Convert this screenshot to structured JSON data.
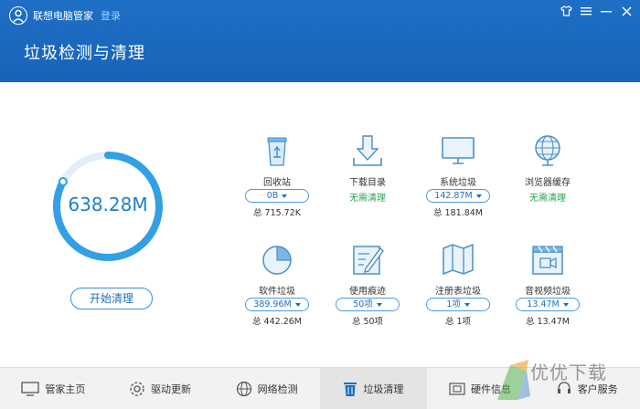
{
  "app": {
    "name": "联想电脑管家",
    "login": "登录",
    "page_title": "垃圾检测与清理"
  },
  "summary": {
    "total": "638.28M",
    "progress_fraction": 0.83,
    "start_button": "开始清理"
  },
  "items": [
    {
      "key": "recycle",
      "label": "回收站",
      "pill": "0B",
      "status": "",
      "total": "总 715.72K",
      "icon": "recycle-bin-icon"
    },
    {
      "key": "download",
      "label": "下载目录",
      "pill": "",
      "status": "无需清理",
      "total": "",
      "icon": "download-icon"
    },
    {
      "key": "system",
      "label": "系统垃圾",
      "pill": "142.87M",
      "status": "",
      "total": "总 181.84M",
      "icon": "monitor-icon"
    },
    {
      "key": "browser",
      "label": "浏览器缓存",
      "pill": "",
      "status": "无需清理",
      "total": "",
      "icon": "globe-icon"
    },
    {
      "key": "software",
      "label": "软件垃圾",
      "pill": "389.96M",
      "status": "",
      "total": "总 442.26M",
      "icon": "pie-chart-icon"
    },
    {
      "key": "traces",
      "label": "使用痕迹",
      "pill": "50项",
      "status": "",
      "total": "总 50项",
      "icon": "pencil-icon"
    },
    {
      "key": "registry",
      "label": "注册表垃圾",
      "pill": "1项",
      "status": "",
      "total": "总 1项",
      "icon": "map-icon"
    },
    {
      "key": "media",
      "label": "音视频垃圾",
      "pill": "13.47M",
      "status": "",
      "total": "总 13.47M",
      "icon": "clapboard-icon"
    }
  ],
  "tabs": [
    {
      "label": "管家主页",
      "icon": "home-monitor-icon"
    },
    {
      "label": "驱动更新",
      "icon": "gear-icon"
    },
    {
      "label": "网络检测",
      "icon": "globe-icon"
    },
    {
      "label": "垃圾清理",
      "icon": "trash-icon"
    },
    {
      "label": "硬件信息",
      "icon": "hardware-icon"
    },
    {
      "label": "客户服务",
      "icon": "service-icon"
    }
  ],
  "watermark": {
    "text": "优优下载"
  },
  "colors": {
    "header": "#1f6fc6",
    "accent": "#1d7fcd",
    "ok": "#2aa44a"
  }
}
